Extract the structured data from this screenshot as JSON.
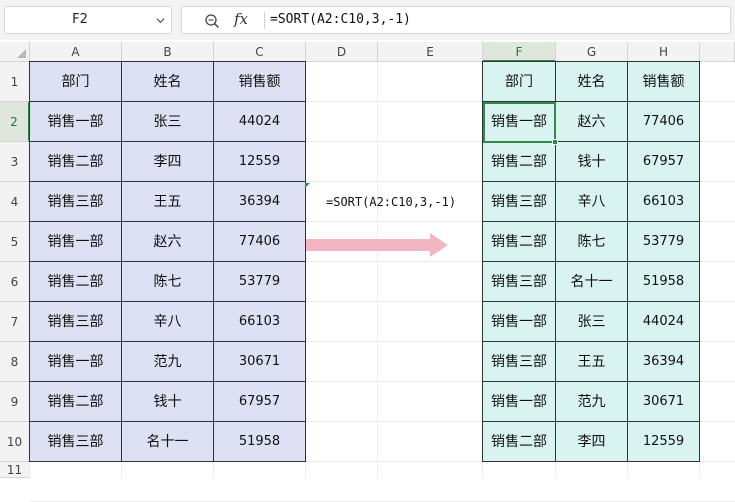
{
  "name_box": "F2",
  "formula": "=SORT(A2:C10,3,-1)",
  "formula_note": "=SORT(A2:C10,3,-1)",
  "columns": [
    "A",
    "B",
    "C",
    "D",
    "E",
    "F",
    "G",
    "H"
  ],
  "rows": [
    "1",
    "2",
    "3",
    "4",
    "5",
    "6",
    "7",
    "8",
    "9",
    "10",
    "11"
  ],
  "source": {
    "headers": [
      "部门",
      "姓名",
      "销售额"
    ],
    "rows": [
      [
        "销售一部",
        "张三",
        "44024"
      ],
      [
        "销售二部",
        "李四",
        "12559"
      ],
      [
        "销售三部",
        "王五",
        "36394"
      ],
      [
        "销售一部",
        "赵六",
        "77406"
      ],
      [
        "销售二部",
        "陈七",
        "53779"
      ],
      [
        "销售三部",
        "辛八",
        "66103"
      ],
      [
        "销售一部",
        "范九",
        "30671"
      ],
      [
        "销售二部",
        "钱十",
        "67957"
      ],
      [
        "销售三部",
        "名十一",
        "51958"
      ]
    ]
  },
  "result": {
    "headers": [
      "部门",
      "姓名",
      "销售额"
    ],
    "rows": [
      [
        "销售一部",
        "赵六",
        "77406"
      ],
      [
        "销售二部",
        "钱十",
        "67957"
      ],
      [
        "销售三部",
        "辛八",
        "66103"
      ],
      [
        "销售二部",
        "陈七",
        "53779"
      ],
      [
        "销售三部",
        "名十一",
        "51958"
      ],
      [
        "销售一部",
        "张三",
        "44024"
      ],
      [
        "销售三部",
        "王五",
        "36394"
      ],
      [
        "销售一部",
        "范九",
        "30671"
      ],
      [
        "销售二部",
        "李四",
        "12559"
      ]
    ]
  },
  "colors": {
    "source_fill": "#dde1f3",
    "result_fill": "#d9f3f1",
    "selection": "#2f8a4a",
    "arrow": "#f2b6c3"
  },
  "icons": [
    "chevron-down-icon",
    "zoom-icon",
    "fx-icon",
    "select-all-icon",
    "right-arrow-icon"
  ]
}
